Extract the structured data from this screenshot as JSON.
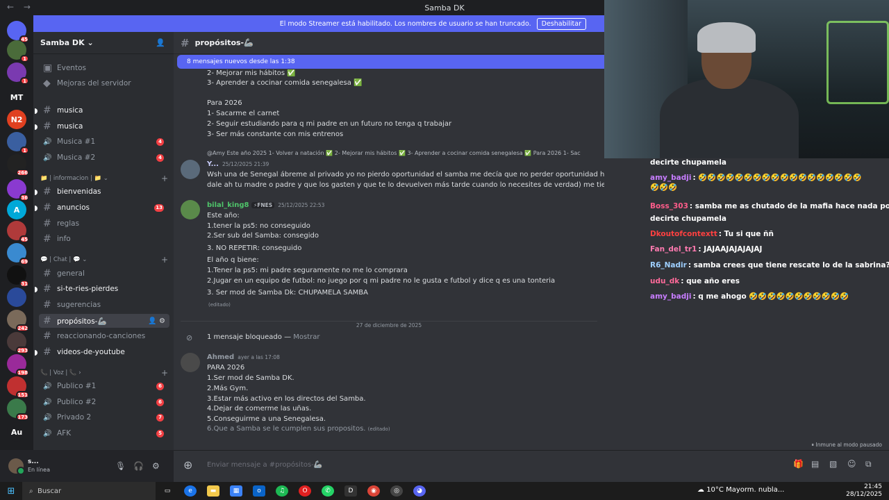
{
  "window": {
    "title": "Samba DK",
    "back": "←",
    "forward": "→"
  },
  "banner": {
    "text": "El modo Streamer está habilitado. Los nombres de usuario se han truncado.",
    "button": "Deshabilitar"
  },
  "servers": [
    {
      "label": "",
      "badge": "45",
      "color": "#5865f2",
      "icon": "discord-icon"
    },
    {
      "label": "",
      "badge": "1",
      "color": "#4a6b3a"
    },
    {
      "label": "",
      "badge": "1",
      "color": "#7a3ab0"
    },
    {
      "label": "MT",
      "badge": "",
      "color": "#1e1f22"
    },
    {
      "label": "N2",
      "badge": "",
      "color": "#e04020"
    },
    {
      "label": "",
      "badge": "1",
      "color": "#3a5fa0"
    },
    {
      "label": "",
      "badge": "266",
      "color": "#222222"
    },
    {
      "label": "",
      "badge": "36",
      "color": "#8a3ad0"
    },
    {
      "label": "A",
      "badge": "",
      "color": "#00a8d8"
    },
    {
      "label": "",
      "badge": "45",
      "color": "#b03a3a"
    },
    {
      "label": "",
      "badge": "69",
      "color": "#3a8ad0"
    },
    {
      "label": "",
      "badge": "31",
      "color": "#111111"
    },
    {
      "label": "",
      "badge": "",
      "color": "#2a4a9a"
    },
    {
      "label": "",
      "badge": "242",
      "color": "#7a6a5a"
    },
    {
      "label": "",
      "badge": "293",
      "color": "#4a3a3a"
    },
    {
      "label": "",
      "badge": "198",
      "color": "#9a2a9a"
    },
    {
      "label": "",
      "badge": "151",
      "color": "#c03030"
    },
    {
      "label": "",
      "badge": "173",
      "color": "#3a7a4a"
    },
    {
      "label": "Au",
      "badge": "",
      "color": "#1e1f22"
    }
  ],
  "sidebar": {
    "server_name": "Samba DK",
    "top_items": [
      {
        "label": "Eventos"
      },
      {
        "label": "Mejoras del servidor"
      }
    ],
    "channels": [
      {
        "label": "musica",
        "type": "text",
        "unread": true
      },
      {
        "label": "musica",
        "type": "text",
        "unread": true
      },
      {
        "label": "Musica #1",
        "type": "voice",
        "badge": "4"
      },
      {
        "label": "Musica #2",
        "type": "voice",
        "badge": "4"
      },
      {
        "label": "bienvenidas",
        "type": "text",
        "unread": true
      },
      {
        "label": "anuncios",
        "type": "text",
        "unread": true,
        "badge": "13"
      },
      {
        "label": "reglas",
        "type": "text"
      },
      {
        "label": "info",
        "type": "text"
      },
      {
        "label": "general",
        "type": "text"
      },
      {
        "label": "si-te-ries-pierdes",
        "type": "text",
        "unread": true
      },
      {
        "label": "sugerencias",
        "type": "text"
      },
      {
        "label": "propósitos-🦾",
        "type": "text",
        "selected": true
      },
      {
        "label": "reaccionando-canciones",
        "type": "text"
      },
      {
        "label": "videos-de-youtube",
        "type": "text",
        "unread": true
      },
      {
        "label": "Publico #1",
        "type": "voice",
        "badge": "6"
      },
      {
        "label": "Publico #2",
        "type": "voice",
        "badge": "6"
      },
      {
        "label": "Privado 2",
        "type": "voice",
        "badge": "7"
      },
      {
        "label": "AFK",
        "type": "voice",
        "badge": "5"
      }
    ],
    "categories": [
      {
        "label": "📁 | informacion | 📁 ⌄"
      },
      {
        "label": "💬 | Chat | 💬 ⌄"
      },
      {
        "label": "📞 | Voz | 📞 ›"
      }
    ]
  },
  "user": {
    "name": "s...",
    "status": "En línea"
  },
  "channel": {
    "name": "propósitos-🦾",
    "new_messages": "8 mensajes nuevos desde las 1:38",
    "composer_placeholder": "Enviar mensaje a #propósitos-🦾",
    "paused": "⏸ Inmune al modo pausado"
  },
  "messages": {
    "top_lines": [
      "2- Mejorar mis hábitos ✅",
      "3- Aprender a cocinar comida senegalesa ✅",
      "Para 2026",
      "1- Sacarme el carnet",
      "2- Seguir estudiando para q mi padre en un futuro no tenga q trabajar",
      "3- Ser más constante con mis entrenos"
    ],
    "reply_ref": "@Amy  Este año 2025 1- Volver a natación ✅ 2- Mejorar mis hábitos ✅ 3- Aprender a cocinar comida senegalesa ✅  Para 2026 1- Sac",
    "m1": {
      "author": "Y...",
      "time": "25/12/2025 21:39",
      "lines": [
        "Wsh una de Senegal ábreme al privado yo no pierdo oportunidad el samba me decía que no perder oportunidad hay q darle ah todas (othmane",
        "dale ah tu madre o padre y que los gasten y que te lo devuelven más tarde cuando lo necesites de verdad) me tienes baneado y el samba me lo dio"
      ]
    },
    "m2": {
      "author": "bilal_king8",
      "tag": "⚡FNES",
      "time": "25/12/2025 22:53",
      "lines": [
        "Este año:",
        "1.tener la ps5: no conseguido",
        "2.Ser sub del Samba: consegido",
        "3. NO REPETIR: conseguido",
        "El año q biene:",
        "1.Tener la ps5: mi padre seguramente no me lo comprara",
        "2.Jugar en un equipo de futbol: no juego por q mi padre no le gusta e futbol y dice q es una tonteria",
        "3. Ser mod de Samba Dk: CHUPAMELA SAMBA"
      ],
      "edited": "(editado)"
    },
    "date_sep": "27 de diciembre de 2025",
    "blocked": "1 mensaje bloqueado — ",
    "blocked_show": "Mostrar",
    "m3": {
      "author": "Ahmed",
      "time": "ayer a las 17:08",
      "lines": [
        "PARA 2026",
        "1.Ser mod de Samba DK.",
        "2.Más Gym.",
        "3.Estar más activo en los directos del Samba.",
        "4.Dejar de comerme las uñas.",
        "5.Conseguirme a una Senegalesa.",
        "6.Que a Samba se le cumplen sus propositos."
      ],
      "edited": "(editado)"
    }
  },
  "stream_chat": [
    {
      "user": "",
      "color": "#ffffff",
      "text": "decirte chupamela"
    },
    {
      "user": "amy_badji",
      "color": "#c77dff",
      "text": ": 🤣🤣🤣🤣🤣🤣🤣🤣🤣🤣🤣🤣🤣🤣🤣🤣🤣🤣"
    },
    {
      "user": "",
      "color": "#ffffff",
      "text": "🤣🤣🤣"
    },
    {
      "user": "Boss_303",
      "color": "#ff5c8a",
      "text": ": samba me as chutado de la mafia hace nada por"
    },
    {
      "user": "",
      "color": "#ffffff",
      "text": "decirte chupamela"
    },
    {
      "user": "Dkoutofcontextt",
      "color": "#ff4040",
      "text": ": Tu si que ññ"
    },
    {
      "user": "Fan_del_tr1",
      "color": "#ff7ab0",
      "text": ": JAJAAJAJAJAJAJ"
    },
    {
      "user": "R6_Nadir",
      "color": "#9ecfff",
      "text": ": samba crees que tiene rescate lo de la sabrina??"
    },
    {
      "user": "udu_dk",
      "color": "#ff6a9a",
      "text": ": que año eres"
    },
    {
      "user": "amy_badji",
      "color": "#c77dff",
      "text": ": q me ahogo 🤣🤣🤣🤣🤣🤣🤣🤣🤣🤣🤣"
    }
  ],
  "taskbar": {
    "search": "Buscar",
    "weather": "10°C  Mayorm. nubla...",
    "time": "21:45",
    "date": "28/12/2025"
  }
}
